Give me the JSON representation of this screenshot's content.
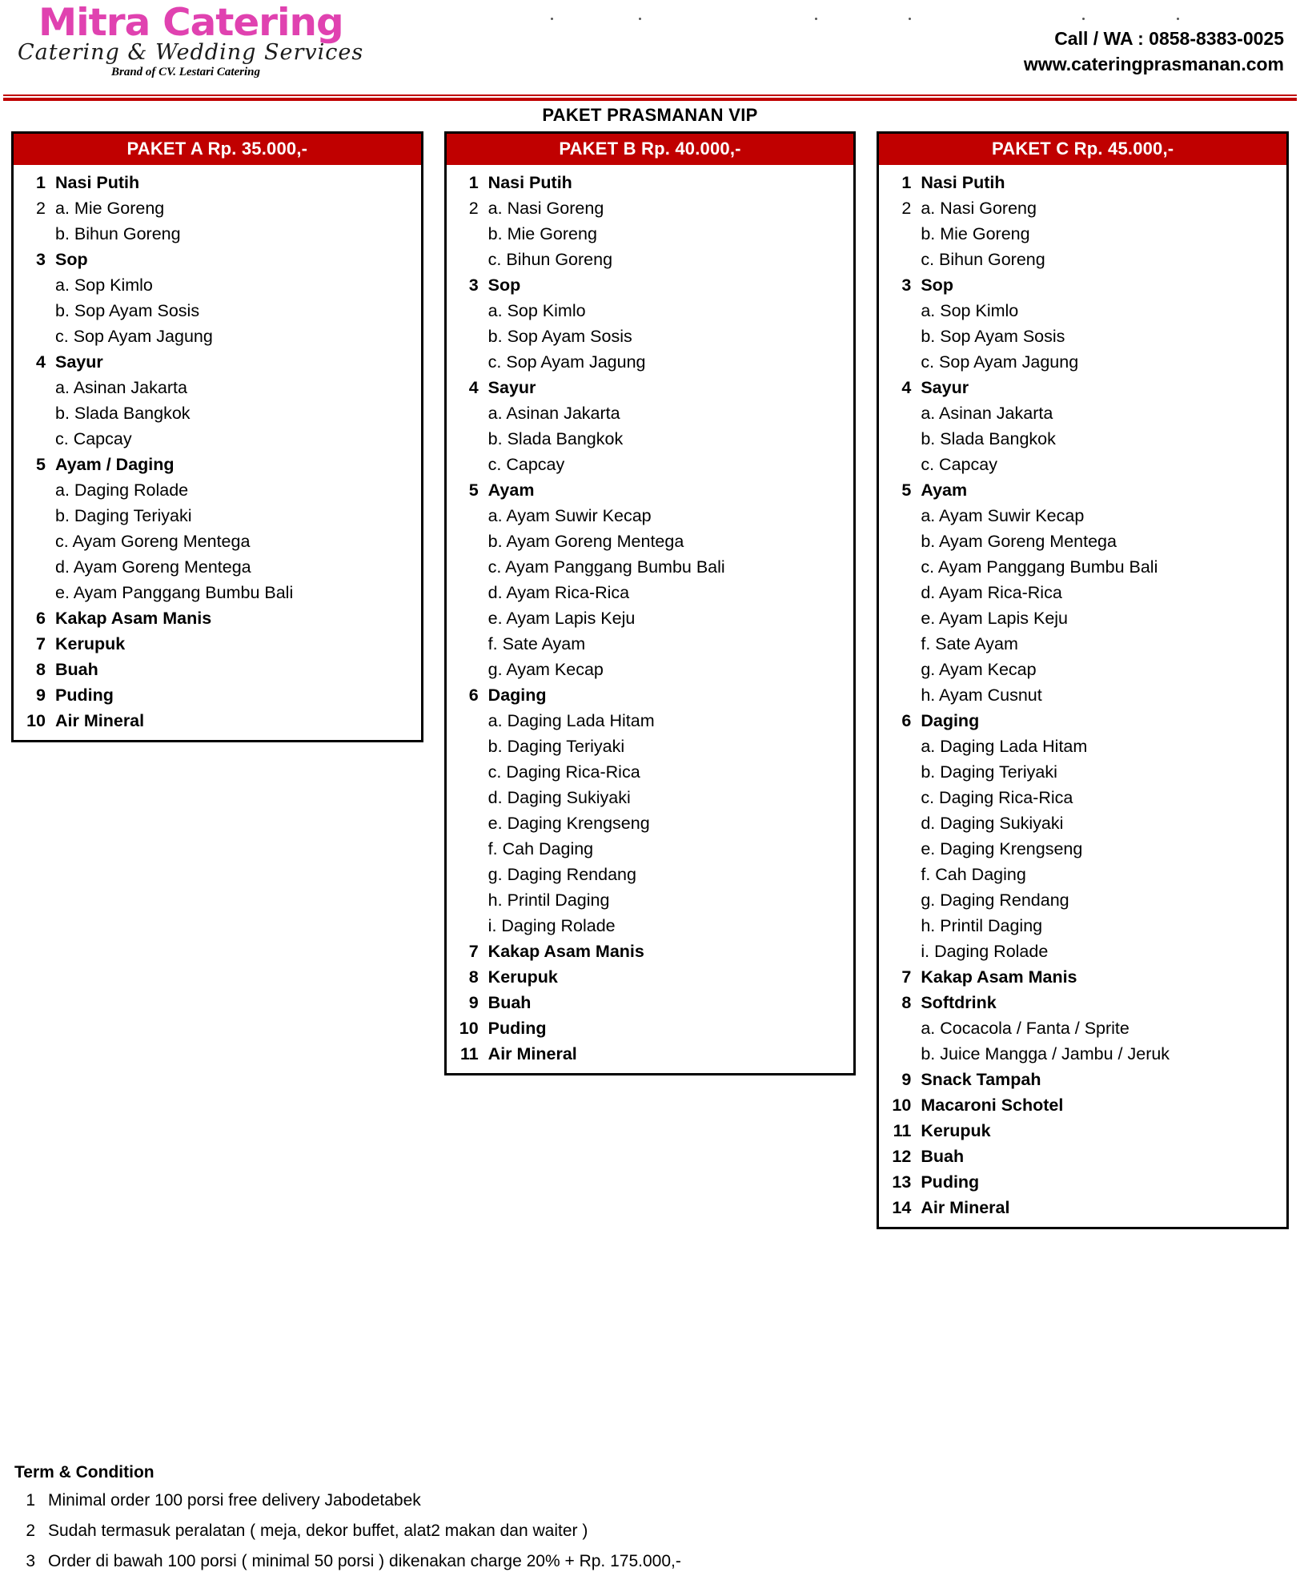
{
  "brand": {
    "name": "Mitra Catering",
    "tagline": "Catering & Wedding Services",
    "subtagline": "Brand of CV. Lestari Catering",
    "accent_pink": "#e042b0",
    "accent_red": "#c00000"
  },
  "contact": {
    "phone": "Call / WA : 0858-8383-0025",
    "website": "www.cateringprasmanan.com"
  },
  "page_title": "PAKET PRASMANAN VIP",
  "packages": [
    {
      "header": "PAKET A Rp. 35.000,-",
      "items": [
        {
          "num": "1",
          "label": "Nasi Putih",
          "sub": false
        },
        {
          "num": "2",
          "label": "a. Mie Goreng",
          "sub": true,
          "numbered_sub": true
        },
        {
          "num": "",
          "label": "b. Bihun Goreng",
          "sub": true
        },
        {
          "num": "3",
          "label": "Sop",
          "sub": false
        },
        {
          "num": "",
          "label": "a. Sop Kimlo",
          "sub": true
        },
        {
          "num": "",
          "label": "b. Sop Ayam Sosis",
          "sub": true
        },
        {
          "num": "",
          "label": "c. Sop Ayam Jagung",
          "sub": true
        },
        {
          "num": "4",
          "label": "Sayur",
          "sub": false
        },
        {
          "num": "",
          "label": "a. Asinan Jakarta",
          "sub": true
        },
        {
          "num": "",
          "label": "b. Slada Bangkok",
          "sub": true
        },
        {
          "num": "",
          "label": "c. Capcay",
          "sub": true
        },
        {
          "num": "5",
          "label": "Ayam / Daging",
          "sub": false
        },
        {
          "num": "",
          "label": "a. Daging Rolade",
          "sub": true
        },
        {
          "num": "",
          "label": "b. Daging Teriyaki",
          "sub": true
        },
        {
          "num": "",
          "label": "c. Ayam Goreng Mentega",
          "sub": true
        },
        {
          "num": "",
          "label": "d. Ayam Goreng Mentega",
          "sub": true
        },
        {
          "num": "",
          "label": "e. Ayam Panggang Bumbu Bali",
          "sub": true
        },
        {
          "num": "6",
          "label": "Kakap Asam Manis",
          "sub": false
        },
        {
          "num": "7",
          "label": "Kerupuk",
          "sub": false
        },
        {
          "num": "8",
          "label": "Buah",
          "sub": false
        },
        {
          "num": "9",
          "label": "Puding",
          "sub": false
        },
        {
          "num": "10",
          "label": "Air Mineral",
          "sub": false
        }
      ]
    },
    {
      "header": "PAKET B Rp. 40.000,-",
      "items": [
        {
          "num": "1",
          "label": "Nasi Putih",
          "sub": false
        },
        {
          "num": "2",
          "label": "a. Nasi Goreng",
          "sub": true,
          "numbered_sub": true
        },
        {
          "num": "",
          "label": "b. Mie Goreng",
          "sub": true
        },
        {
          "num": "",
          "label": "c. Bihun Goreng",
          "sub": true
        },
        {
          "num": "3",
          "label": "Sop",
          "sub": false
        },
        {
          "num": "",
          "label": "a. Sop Kimlo",
          "sub": true
        },
        {
          "num": "",
          "label": "b. Sop Ayam Sosis",
          "sub": true
        },
        {
          "num": "",
          "label": "c. Sop Ayam Jagung",
          "sub": true
        },
        {
          "num": "4",
          "label": "Sayur",
          "sub": false
        },
        {
          "num": "",
          "label": "a. Asinan Jakarta",
          "sub": true
        },
        {
          "num": "",
          "label": "b. Slada Bangkok",
          "sub": true
        },
        {
          "num": "",
          "label": "c. Capcay",
          "sub": true
        },
        {
          "num": "5",
          "label": "Ayam",
          "sub": false
        },
        {
          "num": "",
          "label": "a. Ayam Suwir Kecap",
          "sub": true
        },
        {
          "num": "",
          "label": "b. Ayam Goreng Mentega",
          "sub": true
        },
        {
          "num": "",
          "label": "c. Ayam Panggang Bumbu Bali",
          "sub": true
        },
        {
          "num": "",
          "label": "d. Ayam Rica-Rica",
          "sub": true
        },
        {
          "num": "",
          "label": "e. Ayam Lapis Keju",
          "sub": true
        },
        {
          "num": "",
          "label": "f. Sate Ayam",
          "sub": true
        },
        {
          "num": "",
          "label": "g. Ayam Kecap",
          "sub": true
        },
        {
          "num": "6",
          "label": "Daging",
          "sub": false
        },
        {
          "num": "",
          "label": "a. Daging Lada Hitam",
          "sub": true
        },
        {
          "num": "",
          "label": "b. Daging Teriyaki",
          "sub": true
        },
        {
          "num": "",
          "label": "c. Daging Rica-Rica",
          "sub": true
        },
        {
          "num": "",
          "label": "d. Daging Sukiyaki",
          "sub": true
        },
        {
          "num": "",
          "label": "e. Daging Krengseng",
          "sub": true
        },
        {
          "num": "",
          "label": "f. Cah Daging",
          "sub": true
        },
        {
          "num": "",
          "label": "g. Daging Rendang",
          "sub": true
        },
        {
          "num": "",
          "label": "h. Printil Daging",
          "sub": true
        },
        {
          "num": "",
          "label": "i. Daging Rolade",
          "sub": true
        },
        {
          "num": "7",
          "label": "Kakap Asam Manis",
          "sub": false
        },
        {
          "num": "8",
          "label": "Kerupuk",
          "sub": false
        },
        {
          "num": "9",
          "label": "Buah",
          "sub": false
        },
        {
          "num": "10",
          "label": "Puding",
          "sub": false
        },
        {
          "num": "11",
          "label": "Air Mineral",
          "sub": false
        }
      ]
    },
    {
      "header": "PAKET C Rp. 45.000,-",
      "items": [
        {
          "num": "1",
          "label": "Nasi Putih",
          "sub": false
        },
        {
          "num": "2",
          "label": "a. Nasi Goreng",
          "sub": true,
          "numbered_sub": true
        },
        {
          "num": "",
          "label": "b. Mie Goreng",
          "sub": true
        },
        {
          "num": "",
          "label": "c. Bihun Goreng",
          "sub": true
        },
        {
          "num": "3",
          "label": "Sop",
          "sub": false
        },
        {
          "num": "",
          "label": "a. Sop Kimlo",
          "sub": true
        },
        {
          "num": "",
          "label": "b. Sop Ayam Sosis",
          "sub": true
        },
        {
          "num": "",
          "label": "c. Sop Ayam Jagung",
          "sub": true
        },
        {
          "num": "4",
          "label": "Sayur",
          "sub": false
        },
        {
          "num": "",
          "label": "a. Asinan Jakarta",
          "sub": true
        },
        {
          "num": "",
          "label": "b. Slada Bangkok",
          "sub": true
        },
        {
          "num": "",
          "label": "c. Capcay",
          "sub": true
        },
        {
          "num": "5",
          "label": "Ayam",
          "sub": false
        },
        {
          "num": "",
          "label": "a. Ayam Suwir Kecap",
          "sub": true
        },
        {
          "num": "",
          "label": "b. Ayam Goreng Mentega",
          "sub": true
        },
        {
          "num": "",
          "label": "c. Ayam Panggang Bumbu Bali",
          "sub": true
        },
        {
          "num": "",
          "label": "d. Ayam Rica-Rica",
          "sub": true
        },
        {
          "num": "",
          "label": "e. Ayam Lapis Keju",
          "sub": true
        },
        {
          "num": "",
          "label": "f. Sate Ayam",
          "sub": true
        },
        {
          "num": "",
          "label": "g. Ayam Kecap",
          "sub": true
        },
        {
          "num": "",
          "label": "h. Ayam Cusnut",
          "sub": true
        },
        {
          "num": "6",
          "label": "Daging",
          "sub": false
        },
        {
          "num": "",
          "label": "a. Daging Lada Hitam",
          "sub": true
        },
        {
          "num": "",
          "label": "b. Daging Teriyaki",
          "sub": true
        },
        {
          "num": "",
          "label": "c. Daging Rica-Rica",
          "sub": true
        },
        {
          "num": "",
          "label": "d. Daging Sukiyaki",
          "sub": true
        },
        {
          "num": "",
          "label": "e. Daging Krengseng",
          "sub": true
        },
        {
          "num": "",
          "label": "f. Cah Daging",
          "sub": true
        },
        {
          "num": "",
          "label": "g. Daging Rendang",
          "sub": true
        },
        {
          "num": "",
          "label": "h. Printil Daging",
          "sub": true
        },
        {
          "num": "",
          "label": "i. Daging Rolade",
          "sub": true
        },
        {
          "num": "7",
          "label": "Kakap Asam Manis",
          "sub": false
        },
        {
          "num": "8",
          "label": "Softdrink",
          "sub": false
        },
        {
          "num": "",
          "label": "a. Cocacola / Fanta / Sprite",
          "sub": true
        },
        {
          "num": "",
          "label": "b. Juice Mangga / Jambu / Jeruk",
          "sub": true
        },
        {
          "num": "9",
          "label": "Snack Tampah",
          "sub": false
        },
        {
          "num": "10",
          "label": "Macaroni Schotel",
          "sub": false
        },
        {
          "num": "11",
          "label": "Kerupuk",
          "sub": false
        },
        {
          "num": "12",
          "label": "Buah",
          "sub": false
        },
        {
          "num": "13",
          "label": "Puding",
          "sub": false
        },
        {
          "num": "14",
          "label": "Air Mineral",
          "sub": false
        }
      ]
    }
  ],
  "terms": {
    "title": "Term & Condition",
    "items": [
      {
        "num": "1",
        "text": "Minimal order 100 porsi free delivery Jabodetabek"
      },
      {
        "num": "2",
        "text": "Sudah termasuk peralatan ( meja, dekor buffet, alat2 makan dan waiter )"
      },
      {
        "num": "3",
        "text": "Order di bawah 100 porsi ( minimal 50 porsi ) dikenakan charge 20% + Rp. 175.000,-"
      }
    ]
  }
}
